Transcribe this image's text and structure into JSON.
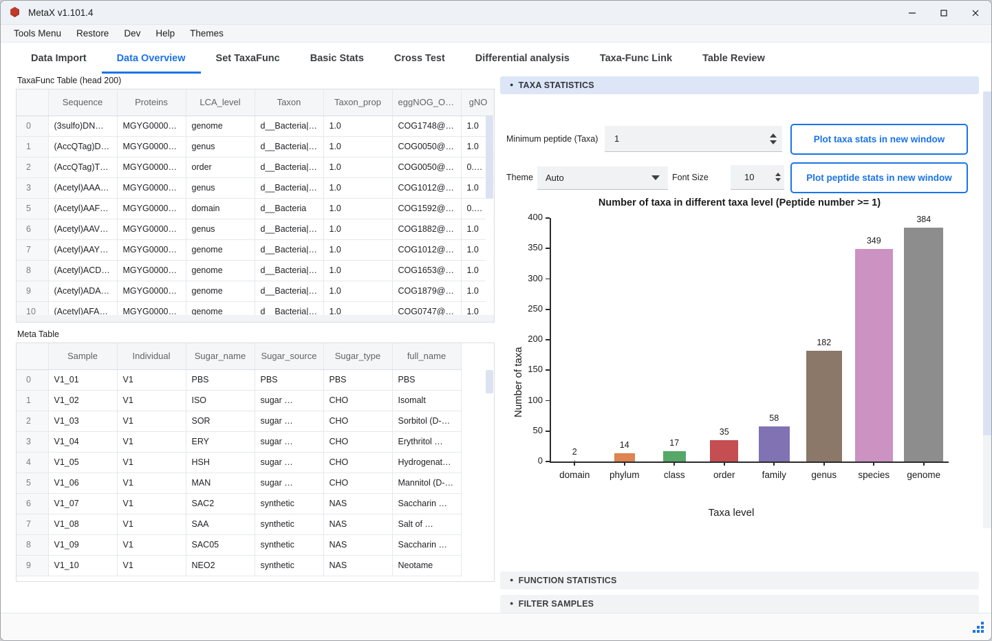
{
  "window": {
    "title": "MetaX v1.101.4",
    "icon": "hexagon-app-icon",
    "minimize": "minimize-icon",
    "maximize": "maximize-icon",
    "close": "close-icon"
  },
  "menubar": {
    "items": [
      "Tools Menu",
      "Restore",
      "Dev",
      "Help",
      "Themes"
    ]
  },
  "tabs": [
    {
      "label": "Data Import",
      "active": false
    },
    {
      "label": "Data Overview",
      "active": true
    },
    {
      "label": "Set TaxaFunc",
      "active": false
    },
    {
      "label": "Basic Stats",
      "active": false
    },
    {
      "label": "Cross Test",
      "active": false
    },
    {
      "label": "Differential analysis",
      "active": false
    },
    {
      "label": "Taxa-Func Link",
      "active": false
    },
    {
      "label": "Table Review",
      "active": false
    }
  ],
  "taxafunc_table": {
    "caption": "TaxaFunc Table (head 200)",
    "columns": [
      "",
      "Sequence",
      "Proteins",
      "LCA_level",
      "Taxon",
      "Taxon_prop",
      "eggNOG_OGs",
      "gNO"
    ],
    "rows": [
      [
        "0",
        "(3sulfo)DN…",
        "MGYG0000…",
        "genome",
        "d__Bacteria|…",
        "1.0",
        "COG1748@…",
        "1.0"
      ],
      [
        "1",
        "(AccQTag)D…",
        "MGYG0000…",
        "genus",
        "d__Bacteria|…",
        "1.0",
        "COG0050@…",
        "1.0"
      ],
      [
        "2",
        "(AccQTag)T…",
        "MGYG0000…",
        "order",
        "d__Bacteria|…",
        "1.0",
        "COG0050@…",
        "0.…"
      ],
      [
        "3",
        "(Acetyl)AAA…",
        "MGYG0000…",
        "genus",
        "d__Bacteria|…",
        "1.0",
        "COG1012@…",
        "1.0"
      ],
      [
        "5",
        "(Acetyl)AAF…",
        "MGYG0000…",
        "domain",
        "d__Bacteria",
        "1.0",
        "COG1592@…",
        "0.…"
      ],
      [
        "6",
        "(Acetyl)AAV…",
        "MGYG0000…",
        "genus",
        "d__Bacteria|…",
        "1.0",
        "COG1882@…",
        "1.0"
      ],
      [
        "7",
        "(Acetyl)AAY…",
        "MGYG0000…",
        "genome",
        "d__Bacteria|…",
        "1.0",
        "COG1012@…",
        "1.0"
      ],
      [
        "8",
        "(Acetyl)ACD…",
        "MGYG0000…",
        "genome",
        "d__Bacteria|…",
        "1.0",
        "COG1653@…",
        "1.0"
      ],
      [
        "9",
        "(Acetyl)ADA…",
        "MGYG0000…",
        "genome",
        "d__Bacteria|…",
        "1.0",
        "COG1879@…",
        "1.0"
      ],
      [
        "10",
        "(Acetyl)AFA…",
        "MGYG0000…",
        "genome",
        "d__Bacteria|…",
        "1.0",
        "COG0747@…",
        "1.0"
      ]
    ]
  },
  "meta_table": {
    "caption": "Meta Table",
    "columns": [
      "",
      "Sample",
      "Individual",
      "Sugar_name",
      "Sugar_source",
      "Sugar_type",
      "full_name"
    ],
    "rows": [
      [
        "0",
        "V1_01",
        "V1",
        "PBS",
        "PBS",
        "PBS",
        "PBS"
      ],
      [
        "1",
        "V1_02",
        "V1",
        "ISO",
        "sugar …",
        "CHO",
        "Isomalt"
      ],
      [
        "2",
        "V1_03",
        "V1",
        "SOR",
        "sugar …",
        "CHO",
        "Sorbitol (D-…"
      ],
      [
        "3",
        "V1_04",
        "V1",
        "ERY",
        "sugar …",
        "CHO",
        "Erythritol …"
      ],
      [
        "4",
        "V1_05",
        "V1",
        "HSH",
        "sugar …",
        "CHO",
        "Hydrogenat…"
      ],
      [
        "5",
        "V1_06",
        "V1",
        "MAN",
        "sugar …",
        "CHO",
        "Mannitol (D-…"
      ],
      [
        "6",
        "V1_07",
        "V1",
        "SAC2",
        "synthetic",
        "NAS",
        "Saccharin …"
      ],
      [
        "7",
        "V1_08",
        "V1",
        "SAA",
        "synthetic",
        "NAS",
        "Salt of …"
      ],
      [
        "8",
        "V1_09",
        "V1",
        "SAC05",
        "synthetic",
        "NAS",
        "Saccharin …"
      ],
      [
        "9",
        "V1_10",
        "V1",
        "NEO2",
        "synthetic",
        "NAS",
        "Neotame"
      ]
    ]
  },
  "taxa_statistics": {
    "header": "TAXA STATISTICS",
    "min_peptide_label": "Minimum peptide  (Taxa)",
    "min_peptide_value": "1",
    "theme_label": "Theme",
    "theme_value": "Auto",
    "font_size_label": "Font Size",
    "font_size_value": "10",
    "plot_taxa_button": "Plot taxa stats in new window",
    "plot_peptide_button": "Plot peptide stats in new window"
  },
  "function_statistics": {
    "header": "FUNCTION STATISTICS"
  },
  "filter_samples": {
    "header": "FILTER SAMPLES"
  },
  "chart_data": {
    "type": "bar",
    "title": "Number of taxa in different taxa level (Peptide number >= 1)",
    "xlabel": "Taxa level",
    "ylabel": "Number of taxa",
    "categories": [
      "domain",
      "phylum",
      "class",
      "order",
      "family",
      "genus",
      "species",
      "genome"
    ],
    "values": [
      2,
      14,
      17,
      35,
      58,
      182,
      349,
      384
    ],
    "colors": [
      "#4c72b0",
      "#dd8452",
      "#55a868",
      "#c44e52",
      "#8172b3",
      "#8c7868",
      "#cc92c2",
      "#8d8d8d"
    ],
    "ylim": [
      0,
      400
    ],
    "yticks": [
      0,
      50,
      100,
      150,
      200,
      250,
      300,
      350,
      400
    ],
    "grid": false,
    "legend": "none"
  }
}
